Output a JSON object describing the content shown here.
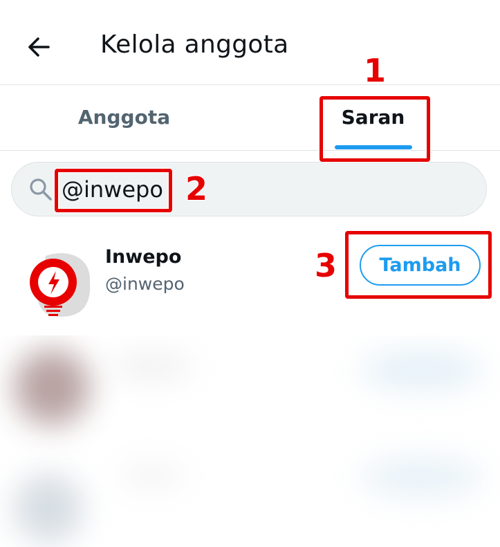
{
  "header": {
    "title": "Kelola anggota"
  },
  "tabs": [
    {
      "label": "Anggota",
      "active": false
    },
    {
      "label": "Saran",
      "active": true
    }
  ],
  "search": {
    "value": "@inwepo",
    "placeholder": ""
  },
  "user": {
    "name": "Inwepo",
    "handle": "@inwepo",
    "action_label": "Tambah"
  },
  "annotations": [
    "1",
    "2",
    "3"
  ],
  "colors": {
    "accent": "#1d9bf0",
    "annotation": "#e60000",
    "muted": "#536471"
  }
}
